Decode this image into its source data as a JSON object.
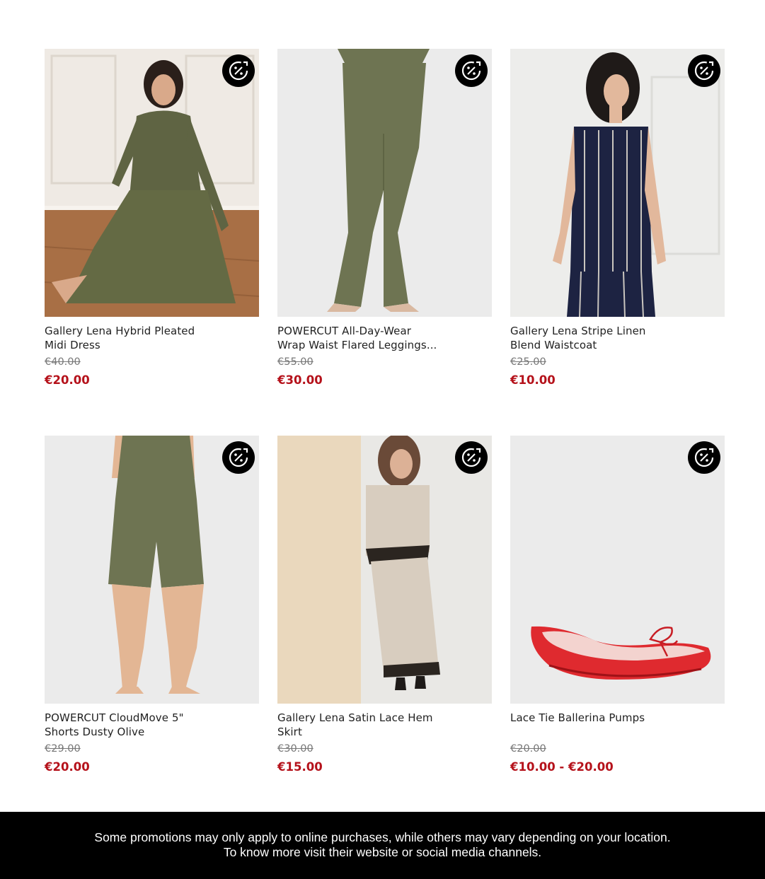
{
  "products": [
    {
      "title_line1": "Gallery Lena Hybrid Pleated",
      "title_line2": "Midi Dress",
      "old_price": "€40.00",
      "price": "€20.00",
      "badge_icon": "discount-badge-icon",
      "image": "olive-midi-dress-photo"
    },
    {
      "title_line1": "POWERCUT All-Day-Wear",
      "title_line2": "Wrap Waist Flared Leggings...",
      "old_price": "€55.00",
      "price": "€30.00",
      "badge_icon": "discount-badge-icon",
      "image": "olive-flared-leggings-photo"
    },
    {
      "title_line1": "Gallery Lena Stripe Linen",
      "title_line2": "Blend Waistcoat",
      "old_price": "€25.00",
      "price": "€10.00",
      "badge_icon": "discount-badge-icon",
      "image": "navy-stripe-waistcoat-photo"
    },
    {
      "title_line1": "POWERCUT CloudMove 5\"",
      "title_line2": "Shorts Dusty Olive",
      "old_price": "€29.00",
      "price": "€20.00",
      "badge_icon": "discount-badge-icon",
      "image": "olive-shorts-photo"
    },
    {
      "title_line1": "Gallery Lena Satin Lace Hem",
      "title_line2": "Skirt",
      "old_price": "€30.00",
      "price": "€15.00",
      "badge_icon": "discount-badge-icon",
      "image": "satin-lace-skirt-photo"
    },
    {
      "title_line1": "Lace Tie Ballerina Pumps",
      "title_line2": "",
      "old_price": "€20.00",
      "price": "€10.00 - €20.00",
      "badge_icon": "discount-badge-icon",
      "image": "red-ballerina-pumps-photo"
    }
  ],
  "footer": {
    "line1": "Some promotions may only apply to online purchases, while others may vary depending on your location.",
    "line2": "To know more visit their website or social media channels."
  },
  "colors": {
    "sale_price": "#b5121b",
    "old_price": "#777777",
    "footer_bg": "#000000",
    "olive": "#5f6443"
  }
}
